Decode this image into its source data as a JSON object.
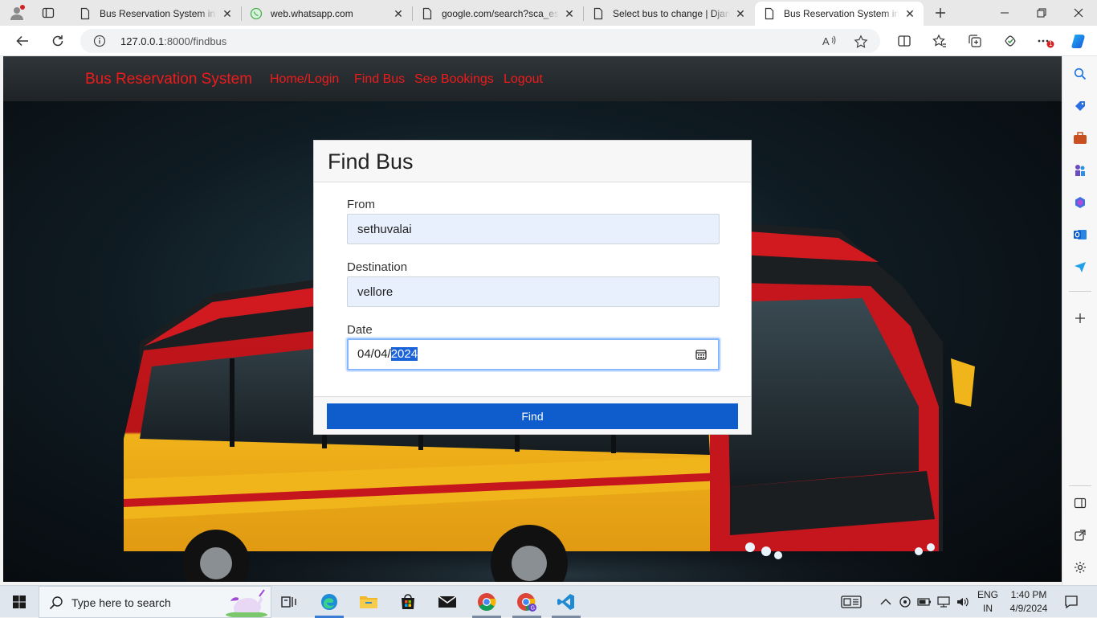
{
  "browser": {
    "tabs": [
      {
        "title": "Bus Reservation System in Dj",
        "icon": "page-icon",
        "active": false
      },
      {
        "title": "web.whatsapp.com",
        "icon": "whatsapp-icon",
        "active": false
      },
      {
        "title": "google.com/search?sca_esv",
        "icon": "page-icon",
        "active": false
      },
      {
        "title": "Select bus to change | Djang",
        "icon": "page-icon",
        "active": false
      },
      {
        "title": "Bus Reservation System in D",
        "icon": "page-icon",
        "active": true
      }
    ],
    "url_host": "127.0.0.1",
    "url_path": ":8000/findbus",
    "extension_badge": "1"
  },
  "site": {
    "brand": "Bus Reservation System",
    "nav": [
      "Home/Login",
      "Find Bus",
      "See Bookings",
      "Logout"
    ]
  },
  "card": {
    "title": "Find Bus",
    "from_label": "From",
    "from_value": "sethuvalai",
    "destination_label": "Destination",
    "destination_value": "vellore",
    "date_label": "Date",
    "date_prefix": "04/04/",
    "date_selected": "2024",
    "button_label": "Find"
  },
  "taskbar": {
    "search_placeholder": "Type here to search",
    "lang_top": "ENG",
    "lang_bottom": "IN",
    "time": "1:40 PM",
    "date": "4/9/2024"
  },
  "colors": {
    "brand_red": "#ee1b1b",
    "button_blue": "#0f5ccd",
    "input_bg": "#e8f0fe"
  }
}
